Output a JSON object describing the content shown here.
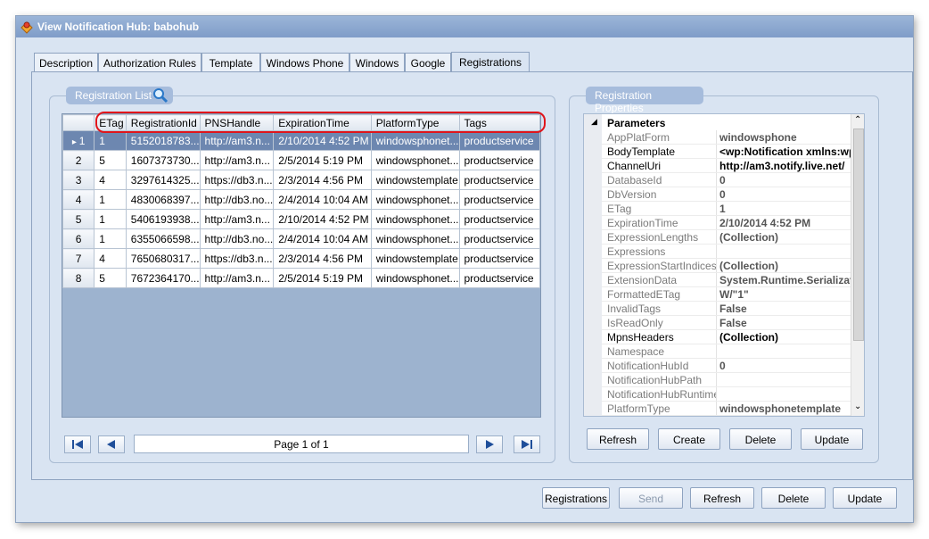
{
  "window": {
    "title": "View Notification Hub: babohub"
  },
  "tabs": [
    {
      "label": "Description"
    },
    {
      "label": "Authorization Rules"
    },
    {
      "label": "Template"
    },
    {
      "label": "Windows Phone"
    },
    {
      "label": "Windows"
    },
    {
      "label": "Google"
    },
    {
      "label": "Registrations"
    }
  ],
  "active_tab": "Registrations",
  "registration_list": {
    "title": "Registration List",
    "columns": [
      "ETag",
      "RegistrationId",
      "PNSHandle",
      "ExpirationTime",
      "PlatformType",
      "Tags"
    ],
    "rows": [
      {
        "num": "1",
        "cells": [
          "1",
          "5152018783...",
          "http://am3.n...",
          "2/10/2014 4:52 PM",
          "windowsphonet...",
          "productservice"
        ]
      },
      {
        "num": "2",
        "cells": [
          "5",
          "1607373730...",
          "http://am3.n...",
          "2/5/2014 5:19 PM",
          "windowsphonet...",
          "productservice"
        ]
      },
      {
        "num": "3",
        "cells": [
          "4",
          "3297614325...",
          "https://db3.n...",
          "2/3/2014 4:56 PM",
          "windowstemplate",
          "productservice"
        ]
      },
      {
        "num": "4",
        "cells": [
          "1",
          "4830068397...",
          "http://db3.no...",
          "2/4/2014 10:04 AM",
          "windowsphonet...",
          "productservice"
        ]
      },
      {
        "num": "5",
        "cells": [
          "1",
          "5406193938...",
          "http://am3.n...",
          "2/10/2014 4:52 PM",
          "windowsphonet...",
          "productservice"
        ]
      },
      {
        "num": "6",
        "cells": [
          "1",
          "6355066598...",
          "http://db3.no...",
          "2/4/2014 10:04 AM",
          "windowsphonet...",
          "productservice"
        ]
      },
      {
        "num": "7",
        "cells": [
          "4",
          "7650680317...",
          "https://db3.n...",
          "2/3/2014 4:56 PM",
          "windowstemplate",
          "productservice"
        ]
      },
      {
        "num": "8",
        "cells": [
          "5",
          "7672364170...",
          "http://am3.n...",
          "2/5/2014 5:19 PM",
          "windowsphonet...",
          "productservice"
        ]
      }
    ],
    "selected_row": 1,
    "pager": {
      "text": "Page 1 of 1"
    }
  },
  "registration_properties": {
    "title": "Registration Properties",
    "category": "Parameters",
    "items": [
      {
        "name": "AppPlatForm",
        "value": "windowsphone",
        "dark": false
      },
      {
        "name": "BodyTemplate",
        "value": "<wp:Notification xmlns:wp",
        "dark": true
      },
      {
        "name": "ChannelUri",
        "value": "http://am3.notify.live.net/",
        "dark": true
      },
      {
        "name": "DatabaseId",
        "value": "0",
        "dark": false
      },
      {
        "name": "DbVersion",
        "value": "0",
        "dark": false
      },
      {
        "name": "ETag",
        "value": "1",
        "dark": false
      },
      {
        "name": "ExpirationTime",
        "value": "2/10/2014 4:52 PM",
        "dark": false
      },
      {
        "name": "ExpressionLengths",
        "value": "(Collection)",
        "dark": false
      },
      {
        "name": "Expressions",
        "value": "",
        "dark": false
      },
      {
        "name": "ExpressionStartIndices",
        "value": "(Collection)",
        "dark": false
      },
      {
        "name": "ExtensionData",
        "value": "System.Runtime.Serializat",
        "dark": false
      },
      {
        "name": "FormattedETag",
        "value": "W/\"1\"",
        "dark": false
      },
      {
        "name": "InvalidTags",
        "value": "False",
        "dark": false
      },
      {
        "name": "IsReadOnly",
        "value": "False",
        "dark": false
      },
      {
        "name": "MpnsHeaders",
        "value": "(Collection)",
        "dark": true
      },
      {
        "name": "Namespace",
        "value": "",
        "dark": false
      },
      {
        "name": "NotificationHubId",
        "value": "0",
        "dark": false
      },
      {
        "name": "NotificationHubPath",
        "value": "",
        "dark": false
      },
      {
        "name": "NotificationHubRuntimeUr",
        "value": "",
        "dark": false
      },
      {
        "name": "PlatformType",
        "value": "windowsphonetemplate",
        "dark": false
      }
    ],
    "buttons": {
      "refresh": "Refresh",
      "create": "Create",
      "delete": "Delete",
      "update": "Update"
    }
  },
  "bottom_buttons": {
    "registrations": "Registrations",
    "send": "Send",
    "refresh": "Refresh",
    "delete": "Delete",
    "update": "Update"
  },
  "colors": {
    "window_bg": "#d9e4f2",
    "selected_row": "#6d87b0",
    "highlight_outline": "#e0151b",
    "group_header": "#a6bcdc"
  }
}
